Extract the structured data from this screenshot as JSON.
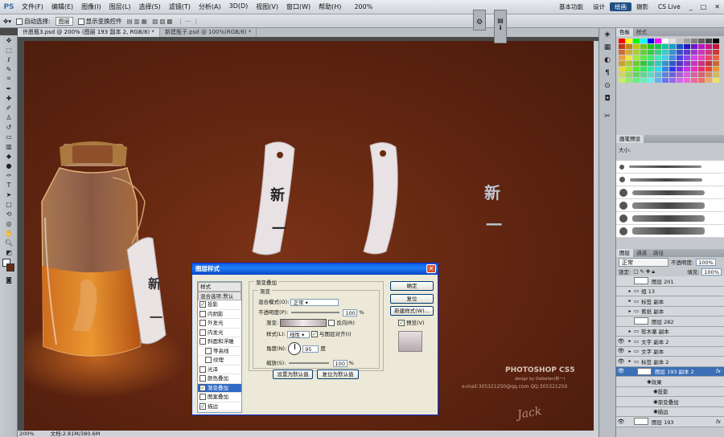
{
  "app_logo": "PS",
  "menu": [
    "文件(F)",
    "编辑(E)",
    "图像(I)",
    "图层(L)",
    "选择(S)",
    "滤镜(T)",
    "分析(A)",
    "3D(D)",
    "视图(V)",
    "窗口(W)",
    "帮助(H)"
  ],
  "zoom_menu": "200%",
  "workspaces": {
    "basic": "基本功能",
    "design": "设计",
    "paint": "绘画",
    "photo": "摄影"
  },
  "cs_live": "CS Live",
  "options": {
    "auto_select_label": "自动选择:",
    "auto_select_value": "图层",
    "show_transform": "显示变换控件"
  },
  "doc_tabs": [
    "许愿瓶3.psd @ 200% (图层 193 副本 2, RGB/8) *",
    "新建瓶子.psd @ 100%(RGB/8) *"
  ],
  "canvas": {
    "tag_text_1": "新",
    "tag_text_2": "一",
    "brand": "PHOTOSHOP CS5",
    "brand_sub": "design by Daibefan(新一)",
    "email": "e-mail:305321250@qq.com QQ:305321250",
    "signature": "Jack"
  },
  "status": {
    "zoom": "200%",
    "doc": "文档:2.81M/380.6M"
  },
  "panels": {
    "color_tabs": [
      "色板",
      "样式"
    ],
    "brush_tabs": [
      "画笔预设"
    ],
    "brush_size_label": "大小:",
    "layer_tabs": [
      "图层",
      "通道",
      "路径"
    ],
    "blend_mode": "正常",
    "opacity_label": "不透明度:",
    "opacity": "100%",
    "lock_label": "锁定:",
    "fill_label": "填充:",
    "fill": "100%",
    "layers": [
      {
        "name": "图层 201",
        "eye": false,
        "kind": "thumb"
      },
      {
        "name": "组 13",
        "eye": false,
        "kind": "group"
      },
      {
        "name": "标签 副本",
        "eye": false,
        "kind": "group"
      },
      {
        "name": "蕉纸 副本",
        "eye": false,
        "kind": "group"
      },
      {
        "name": "图层 282",
        "eye": false,
        "kind": "thumb"
      },
      {
        "name": "软木塞 副本",
        "eye": false,
        "kind": "group"
      },
      {
        "name": "文字 副本 2",
        "eye": true,
        "kind": "group"
      },
      {
        "name": "文字 副本",
        "eye": true,
        "kind": "group"
      },
      {
        "name": "标签 副本 2",
        "eye": true,
        "kind": "group"
      },
      {
        "name": "图层 193 副本 2",
        "eye": true,
        "kind": "selected",
        "fx": "fx"
      },
      {
        "name": "效果",
        "eye": false,
        "kind": "fx-head"
      },
      {
        "name": "投影",
        "eye": false,
        "kind": "fx"
      },
      {
        "name": "渐变叠加",
        "eye": false,
        "kind": "fx"
      },
      {
        "name": "描边",
        "eye": false,
        "kind": "fx"
      },
      {
        "name": "图层 193",
        "eye": true,
        "kind": "thumb",
        "fx": "fx"
      }
    ]
  },
  "dialog": {
    "title": "图层样式",
    "styles": [
      {
        "label": "样式",
        "hdr": true
      },
      {
        "label": "混合选项:默认",
        "hdr": true
      },
      {
        "label": "投影",
        "checked": true
      },
      {
        "label": "内阴影",
        "checked": false
      },
      {
        "label": "外发光",
        "checked": false
      },
      {
        "label": "内发光",
        "checked": false
      },
      {
        "label": "斜面和浮雕",
        "checked": false
      },
      {
        "label": "等高线",
        "checked": false,
        "indent": true
      },
      {
        "label": "纹理",
        "checked": false,
        "indent": true
      },
      {
        "label": "光泽",
        "checked": false
      },
      {
        "label": "颜色叠加",
        "checked": false
      },
      {
        "label": "渐变叠加",
        "checked": true,
        "on": true
      },
      {
        "label": "图案叠加",
        "checked": false
      },
      {
        "label": "描边",
        "checked": true
      }
    ],
    "group_title": "渐变叠加",
    "sub_title": "渐变",
    "blend_label": "混合模式(O):",
    "blend_value": "正常",
    "opacity_label": "不透明度(P):",
    "opacity_value": "100",
    "pct": "%",
    "gradient_label": "渐变:",
    "reverse_label": "反向(R)",
    "style_label": "样式(L):",
    "style_value": "线性",
    "align_label": "与图层对齐(I)",
    "angle_label": "角度(N):",
    "angle_value": "95",
    "deg": "度",
    "scale_label": "缩放(S):",
    "scale_value": "100",
    "btn_default": "设置为默认值",
    "btn_reset_default": "复位为默认值",
    "ok": "确定",
    "reset": "复位",
    "new_style": "新建样式(W)...",
    "preview": "预览(V)"
  },
  "colors": {
    "accent": "#1d4f86",
    "canvas": "#5e2410",
    "dialog_bg": "#ece9d8",
    "selected": "#316ac5"
  }
}
